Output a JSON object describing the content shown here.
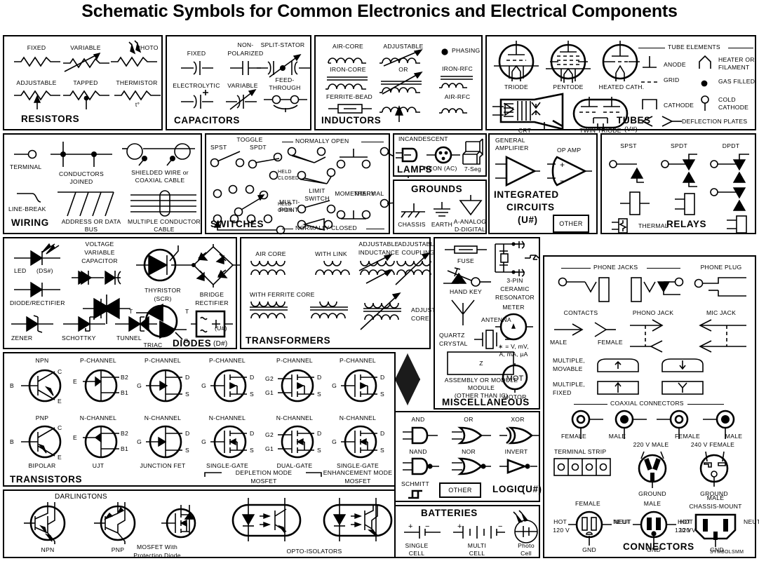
{
  "title": "Schematic Symbols for Common Electronics and Electrical Components",
  "watermark": "SYMBOLSMM",
  "panels": {
    "resistors": {
      "title": "RESISTORS",
      "labels": [
        "FIXED",
        "VARIABLE",
        "PHOTO",
        "ADJUSTABLE",
        "TAPPED",
        "THERMISTOR",
        "t°"
      ]
    },
    "capacitors": {
      "title": "CAPACITORS",
      "labels": [
        "FIXED",
        "NON-",
        "POLARIZED",
        "SPLIT-STATOR",
        "ELECTROLYTIC",
        "VARIABLE",
        "FEED-",
        "THROUGH",
        "+"
      ]
    },
    "inductors": {
      "title": "INDUCTORS",
      "labels": [
        "AIR-CORE",
        "IRON-CORE",
        "FERRITE-BEAD",
        "ADJUSTABLE",
        "OR",
        "PHASING",
        "IRON-RFC",
        "AIR-RFC"
      ]
    },
    "tubes": {
      "title": "TUBES",
      "designator": "(V#)",
      "labels": [
        "TRIODE",
        "PENTODE",
        "HEATED CATH.",
        "CRT",
        "TWIN TRIODE"
      ],
      "elements_header": "TUBE ELEMENTS",
      "elements": [
        "ANODE",
        "GRID",
        "CATHODE",
        "HEATER OR FILAMENT",
        "GAS FILLED",
        "COLD CATHODE",
        "DEFLECTION PLATES"
      ]
    },
    "wiring": {
      "title": "WIRING",
      "labels": [
        "TERMINAL",
        "CONDUCTORS JOINED",
        "SHIELDED WIRE or COAXIAL CABLE",
        "LINE-BREAK",
        "ADDRESS OR DATA BUS",
        "MULTIPLE CONDUCTOR CABLE"
      ]
    },
    "switches": {
      "title": "SWITCHES",
      "labels": [
        "TOGGLE",
        "SPST",
        "SPDT",
        "MULTI-",
        "POINT",
        "NORMALLY OPEN",
        "NORMALLY CLOSED",
        "HELD CLOSED",
        "HELD OPEN",
        "LIMIT",
        "SWITCH",
        "MOMENTARY",
        "THERMAL"
      ]
    },
    "lamps": {
      "title": "LAMPS",
      "labels": [
        "INCANDESCENT",
        "NEON (AC)",
        "7-Seg"
      ]
    },
    "grounds": {
      "title": "GROUNDS",
      "labels": [
        "CHASSIS",
        "EARTH",
        "A-ANALOG",
        "D-DIGITAL"
      ]
    },
    "integrated_circuits": {
      "title": "INTEGRATED CIRCUITS",
      "designator": "(U#)",
      "labels": [
        "GENERAL AMPLIFIER",
        "OP AMP",
        "+",
        "−"
      ],
      "other_label": "OTHER"
    },
    "relays": {
      "title": "RELAYS",
      "labels": [
        "SPST",
        "SPDT",
        "DPDT",
        "THERMAL"
      ]
    },
    "diodes": {
      "title": "DIODES",
      "designator": "(D#)",
      "labels": [
        "LED",
        "(DS#)",
        "DIODE/RECTIFIER",
        "ZENER",
        "SCHOTTKY",
        "TUNNEL",
        "VOLTAGE VARIABLE CAPACITOR",
        "THYRISTOR",
        "(SCR)",
        "TRIAC",
        "T",
        "G",
        "BRIDGE RECTIFIER",
        "(U#)"
      ]
    },
    "transformers": {
      "title": "TRANSFORMERS",
      "labels": [
        "AIR CORE",
        "WITH LINK",
        "ADJUSTABLE INDUCTANCE",
        "ADJUSTABLE COUPLING",
        "WITH FERRITE CORE",
        "ADJUSTABLE CORE"
      ]
    },
    "miscellaneous": {
      "title": "MISCELLANEOUS",
      "labels": [
        "FUSE",
        "HAND KEY",
        "ANTENNA",
        "QUARTZ CRYSTAL",
        "Z",
        "ASSEMBLY OR MODULE",
        "(OTHER THAN IC)",
        "3-PIN CERAMIC RESONATOR",
        "METER",
        "∗ = V, mV,",
        "A, mA, µA",
        "MOT",
        "MOTOR"
      ]
    },
    "transistors": {
      "title": "TRANSISTORS",
      "row1": [
        "NPN",
        "P-CHANNEL",
        "P-CHANNEL",
        "P-CHANNEL",
        "P-CHANNEL",
        "P-CHANNEL"
      ],
      "row2": [
        "PNP",
        "N-CHANNEL",
        "N-CHANNEL",
        "N-CHANNEL",
        "N-CHANNEL",
        "N-CHANNEL"
      ],
      "family": [
        "BIPOLAR",
        "UJT",
        "JUNCTION FET",
        "SINGLE-GATE",
        "DUAL-GATE",
        "SINGLE-GATE"
      ],
      "mode_left": "DEPLETION MODE",
      "mode_left2": "MOSFET",
      "mode_right": "ENHANCEMENT MODE",
      "mode_right2": "MOSFET",
      "pins": [
        "B",
        "C",
        "E",
        "E",
        "B2",
        "B1",
        "G",
        "D",
        "S",
        "G1",
        "G2"
      ],
      "darlingtons": "DARLINGTONS",
      "darlington_types": [
        "NPN",
        "PNP"
      ],
      "mosfet_protection": "MOSFET With Protection Diode",
      "opto": "OPTO-ISOLATORS"
    },
    "logic": {
      "title": "LOGIC",
      "designator": "(U#)",
      "gates": [
        "AND",
        "OR",
        "XOR",
        "NAND",
        "NOR",
        "INVERT"
      ],
      "schmitt": "SCHMITT",
      "other_label": "OTHER"
    },
    "batteries": {
      "title": "BATTERIES",
      "labels": [
        "SINGLE CELL",
        "MULTI CELL",
        "Photo Cell",
        "+",
        "−"
      ]
    },
    "connectors": {
      "title": "CONNECTORS",
      "phone_jacks_header": "PHONE JACKS",
      "phone_plug": "PHONE PLUG",
      "contacts": "CONTACTS",
      "male": "MALE",
      "female": "FEMALE",
      "phono_jack": "PHONO JACK",
      "mic_jack": "MIC JACK",
      "multiple_movable": "MULTIPLE, MOVABLE",
      "multiple_fixed": "MULTIPLE, FIXED",
      "coax_header": "COAXIAL CONNECTORS",
      "coax_labels": [
        "FEMALE",
        "MALE",
        "FEMALE",
        "MALE"
      ],
      "terminal_strip": "TERMINAL STRIP",
      "plug_220": "220 V MALE",
      "plug_240": "240 V FEMALE",
      "ground": "GROUND",
      "outlet_female": "FEMALE",
      "outlet_male": "MALE",
      "outlet_male_chassis": "MALE CHASSIS-MOUNT",
      "hot": "HOT",
      "volt120": "120 V",
      "neut": "NEUT",
      "gnd": "GND"
    }
  }
}
